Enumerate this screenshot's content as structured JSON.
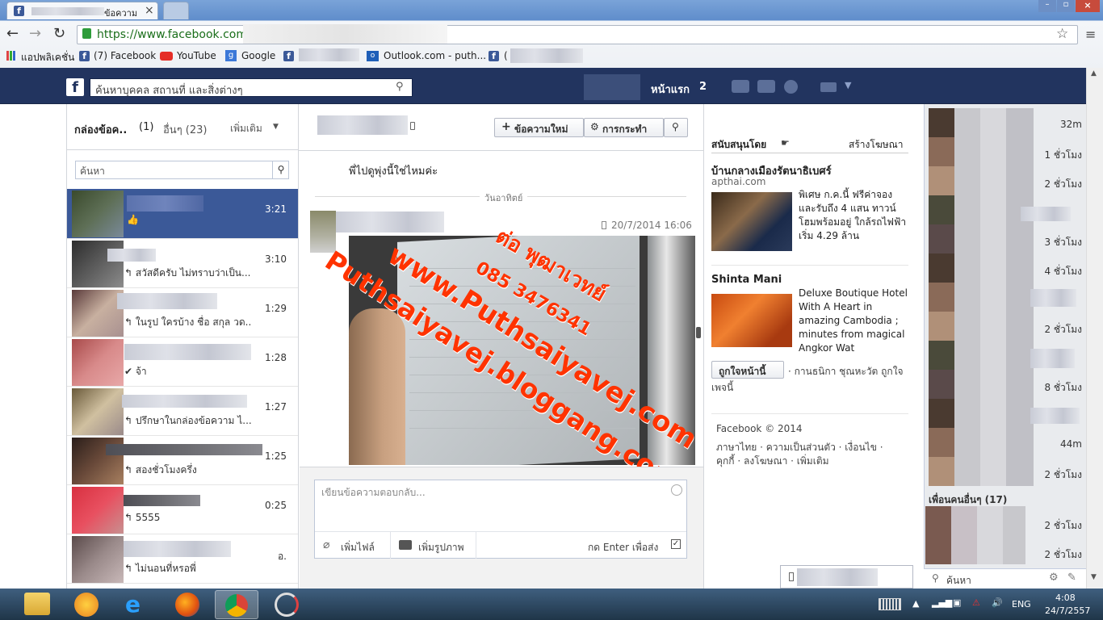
{
  "browser": {
    "tab_title": "ข้อความ",
    "url": "https://www.facebook.com",
    "bookmarks": [
      "แอปพลิเคชั่น",
      "(7) Facebook",
      "YouTube",
      "Google",
      "Outlook.com - puth...",
      "("
    ]
  },
  "fb": {
    "search_placeholder": "ค้นหาบุคคล สถานที่ และสิ่งต่างๆ",
    "home_label": "หน้าแรก",
    "home_count": "2"
  },
  "inbox": {
    "tab_inbox": "กล่องข้อค..",
    "tab_inbox_count": "(1)",
    "tab_other": "อื่นๆ (23)",
    "more": "เพิ่มเติม",
    "search_placeholder": "ค้นหา",
    "conversations": [
      {
        "time": "3:21",
        "snippet": ""
      },
      {
        "time": "3:10",
        "snippet": "↰ สวัสดีครับ ไม่ทราบว่าเป็น..."
      },
      {
        "time": "1:29",
        "snippet": "↰ ในรูป ใครบ้าง ชื่อ สกุล วด.."
      },
      {
        "time": "1:28",
        "snippet": "✔ จ้า"
      },
      {
        "time": "1:27",
        "snippet": "↰ ปรึกษาในกล่องข้อความ ไ..."
      },
      {
        "time": "1:25",
        "snippet": "↰ สองชั่วโมงครึ่ง"
      },
      {
        "time": "0:25",
        "snippet": "↰ 5555"
      },
      {
        "time": "อ.",
        "snippet": "↰ ไม่นอนที่หรอพี่"
      }
    ]
  },
  "thread": {
    "new_message": "ข้อความใหม่",
    "actions": "การกระทำ",
    "msg1": "พี่ไปดูพุ่งนี้ใช่ไหมค่ะ",
    "day_separator": "วันอาทิตย์",
    "msg_time": "20/7/2014 16:06",
    "watermark1": "ต่อ พุฒาเวทย์",
    "watermark2": "085 3476341",
    "watermark3": "www.Puthsaiyavej.com",
    "watermark4": "Puthsaiyavej.bloggang.com",
    "reply_placeholder": "เขียนข้อความตอบกลับ...",
    "add_file": "เพิ่มไฟล์",
    "add_photo": "เพิ่มรูปภาพ",
    "enter_to_send": "กด Enter เพื่อส่ง"
  },
  "ads": {
    "sponsored": "สนับสนุนโดย",
    "create_ad": "สร้างโฆษณา",
    "ad1_title": "บ้านกลางเมืองรัตนาธิเบศร์",
    "ad1_domain": "apthai.com",
    "ad1_text": "พิเศษ ก.ค.นี้ ฟรีค่าจอง และรับถึง 4 แสน ทาวน์โฮมพร้อมอยู่ ใกล้รถไฟฟ้า เริ่ม 4.29 ล้าน",
    "ad2_title": "Shinta Mani",
    "ad2_text": "Deluxe Boutique Hotel With A Heart in amazing Cambodia ; minutes from magical Angkor Wat",
    "like_page": "ถูกใจหน้านี้",
    "liked_by": "· กานธนิกา ชุณหะวัต ถูกใจเพจนี้",
    "footer_copy": "Facebook © 2014",
    "footer_links1": "ภาษาไทย · ความเป็นส่วนตัว · เงื่อนไข ·",
    "footer_links2": "คุกกี้ · ลงโฆษณา · เพิ่มเติม"
  },
  "chat": {
    "times": [
      "32m",
      "1 ชั่วโมง",
      "2 ชั่วโมง",
      "",
      "3 ชั่วโมง",
      "4 ชั่วโมง",
      "",
      "2 ชั่วโมง",
      "",
      "8 ชั่วโมง",
      "",
      "44m",
      "2 ชั่วโมง"
    ],
    "other_friends": "เพื่อนคนอื่นๆ (17)",
    "other_times": [
      "2 ชั่วโมง",
      "2 ชั่วโมง"
    ],
    "search": "ค้นหา"
  },
  "taskbar": {
    "lang": "ENG",
    "time": "4:08",
    "date": "24/7/2557"
  },
  "colors": {
    "fb_blue": "#3b5998",
    "fb_dark": "#22345f",
    "watermark": "#ff3300"
  }
}
